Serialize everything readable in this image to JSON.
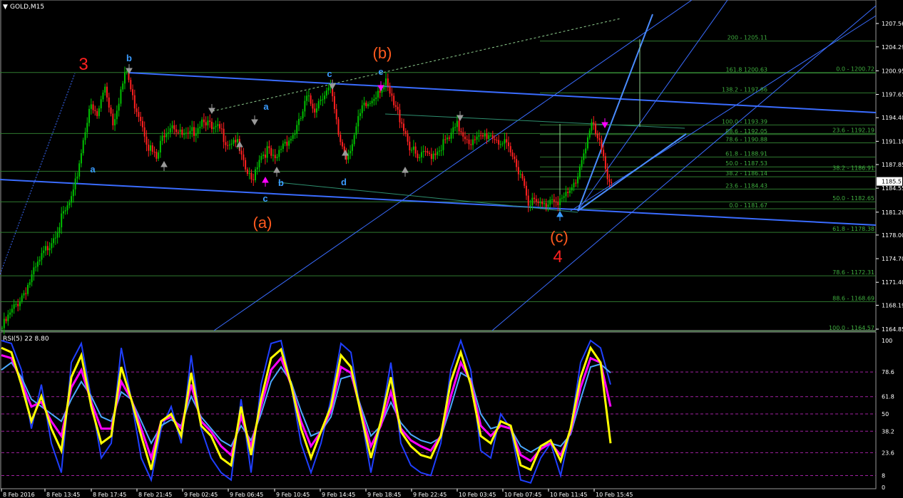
{
  "window": {
    "symbol_title": "GOLD,M15"
  },
  "indicator": {
    "title": "RSI(5) 22 8.80"
  },
  "price_axis": {
    "labels": [
      "1207.56",
      "1204.29",
      "1200.95",
      "1197.65",
      "1194.40",
      "1191.10",
      "1187.85",
      "1185.5",
      "1184.55",
      "1181.20",
      "1178.00",
      "1174.70",
      "1171.40",
      "1168.19",
      "1164.85"
    ],
    "values": [
      1207.56,
      1204.29,
      1200.95,
      1197.65,
      1194.4,
      1191.1,
      1187.85,
      1185.5,
      1184.55,
      1181.2,
      1178.0,
      1174.7,
      1171.4,
      1168.19,
      1164.85
    ],
    "current_label": "1185.5"
  },
  "rsi_axis": {
    "labels": [
      "100",
      "78.6",
      "61.8",
      "50",
      "38.2",
      "23.6",
      "8",
      "0"
    ],
    "values": [
      100,
      78.6,
      61.8,
      50,
      38.2,
      23.6,
      8,
      0
    ]
  },
  "time_axis": [
    "8 Feb 2016",
    "8 Feb 13:45",
    "8 Feb 17:45",
    "8 Feb 21:45",
    "9 Feb 02:45",
    "9 Feb 06:45",
    "9 Feb 10:45",
    "9 Feb 14:45",
    "9 Feb 18:45",
    "9 Feb 22:45",
    "10 Feb 03:45",
    "10 Feb 07:45",
    "10 Feb 11:45",
    "10 Feb 15:45"
  ],
  "wave_labels": [
    {
      "text": "3",
      "color": "#ff2020"
    },
    {
      "text": "b",
      "color": "#3a9bff"
    },
    {
      "text": "a",
      "color": "#3a9bff"
    },
    {
      "text": "a",
      "color": "#3a9bff"
    },
    {
      "text": "c",
      "color": "#3a9bff"
    },
    {
      "text": "b",
      "color": "#3a9bff"
    },
    {
      "text": "(a)",
      "color": "#ff5a1e"
    },
    {
      "text": "c",
      "color": "#3a9bff"
    },
    {
      "text": "d",
      "color": "#3a9bff"
    },
    {
      "text": "e",
      "color": "#3a9bff"
    },
    {
      "text": "(b)",
      "color": "#ff5a1e"
    },
    {
      "text": "(c)",
      "color": "#ff5a1e"
    },
    {
      "text": "4",
      "color": "#ff2020"
    }
  ],
  "fib_labels": [
    {
      "text": "200 - 1205.11",
      "value": 1205.11
    },
    {
      "text": "161.8 1200.63",
      "value": 1200.63
    },
    {
      "text": "0.0 - 1200.72",
      "value": 1200.72
    },
    {
      "text": "138.2 - 1197.86",
      "value": 1197.86
    },
    {
      "text": "100.0 - 1193.39",
      "value": 1193.39
    },
    {
      "text": "88.6 - 1192.05",
      "value": 1192.05
    },
    {
      "text": "23.6 - 1192.19",
      "value": 1192.19
    },
    {
      "text": "78.6 - 1190.88",
      "value": 1190.88
    },
    {
      "text": "61.8 - 1188.91",
      "value": 1188.91
    },
    {
      "text": "50.0 - 1187.53",
      "value": 1187.53
    },
    {
      "text": "38.2 - 1186.91",
      "value": 1186.91
    },
    {
      "text": "38.2 - 1186.14",
      "value": 1186.14
    },
    {
      "text": "23.6 - 1184.43",
      "value": 1184.43
    },
    {
      "text": "50.0 - 1182.65",
      "value": 1182.65
    },
    {
      "text": "0.0 - 1181.67",
      "value": 1181.67
    },
    {
      "text": "61.8 - 1178.38",
      "value": 1178.38
    },
    {
      "text": "78.6 - 1172.31",
      "value": 1172.31
    },
    {
      "text": "88.6 - 1168.69",
      "value": 1168.69
    },
    {
      "text": "100.0 - 1164.57",
      "value": 1164.57
    }
  ],
  "chart_data": {
    "type": "candlestick",
    "symbol": "GOLD",
    "timeframe": "M15",
    "ylim": [
      1164.0,
      1210.0
    ],
    "colors": {
      "bull": "#00c000",
      "bear": "#ff2020",
      "channel": "#3a6cff",
      "fib": "#2f7a2f",
      "rsi_yellow": "#ffff00",
      "rsi_magenta": "#ff00ff",
      "rsi_blue": "#1f3fff",
      "rsi_light": "#4aa8ff"
    },
    "close_path": [
      [
        0,
        1165.0
      ],
      [
        12,
        1170.5
      ],
      [
        20,
        1174.8
      ],
      [
        26,
        1178.0
      ],
      [
        32,
        1181.2
      ],
      [
        36,
        1183.5
      ],
      [
        40,
        1189.8
      ],
      [
        44,
        1195.9
      ],
      [
        48,
        1194.5
      ],
      [
        52,
        1198.9
      ],
      [
        56,
        1193.8
      ],
      [
        60,
        1198.2
      ],
      [
        63,
        1200.9
      ],
      [
        66,
        1197.0
      ],
      [
        70,
        1194.5
      ],
      [
        74,
        1190.5
      ],
      [
        78,
        1188.5
      ],
      [
        82,
        1192.5
      ],
      [
        86,
        1193.8
      ],
      [
        90,
        1192.0
      ],
      [
        94,
        1191.5
      ],
      [
        98,
        1193.0
      ],
      [
        102,
        1194.6
      ],
      [
        106,
        1192.5
      ],
      [
        110,
        1192.7
      ],
      [
        114,
        1191.0
      ],
      [
        118,
        1191.5
      ],
      [
        122,
        1187.6
      ],
      [
        126,
        1185.5
      ],
      [
        130,
        1189.0
      ],
      [
        134,
        1189.9
      ],
      [
        138,
        1188.0
      ],
      [
        142,
        1191.0
      ],
      [
        146,
        1191.6
      ],
      [
        150,
        1193.4
      ],
      [
        154,
        1197.0
      ],
      [
        158,
        1195.8
      ],
      [
        162,
        1197.8
      ],
      [
        166,
        1198.3
      ],
      [
        170,
        1192.0
      ],
      [
        174,
        1189.0
      ],
      [
        178,
        1192.0
      ],
      [
        182,
        1195.5
      ],
      [
        186,
        1196.5
      ],
      [
        190,
        1198.5
      ],
      [
        194,
        1199.0
      ],
      [
        198,
        1196.0
      ],
      [
        202,
        1194.0
      ],
      [
        206,
        1190.5
      ],
      [
        210,
        1188.5
      ],
      [
        214,
        1189.2
      ],
      [
        218,
        1189.5
      ],
      [
        222,
        1190.5
      ],
      [
        226,
        1191.4
      ],
      [
        230,
        1193.2
      ],
      [
        234,
        1192.0
      ],
      [
        238,
        1190.8
      ],
      [
        242,
        1191.5
      ],
      [
        246,
        1192.2
      ],
      [
        250,
        1191.5
      ],
      [
        254,
        1190.5
      ],
      [
        258,
        1188.8
      ],
      [
        262,
        1186.9
      ],
      [
        266,
        1183.0
      ],
      [
        270,
        1182.3
      ],
      [
        274,
        1182.0
      ],
      [
        278,
        1183.5
      ],
      [
        282,
        1182.8
      ],
      [
        286,
        1183.4
      ],
      [
        290,
        1185.5
      ],
      [
        294,
        1189.8
      ],
      [
        298,
        1193.5
      ],
      [
        302,
        1190.5
      ],
      [
        306,
        1186.5
      ],
      [
        309,
        1185.0
      ]
    ],
    "rsi_yellow": [
      95,
      92,
      70,
      45,
      62,
      40,
      25,
      75,
      90,
      55,
      30,
      35,
      82,
      60,
      35,
      12,
      45,
      50,
      35,
      78,
      42,
      35,
      20,
      15,
      55,
      22,
      60,
      88,
      94,
      70,
      40,
      20,
      38,
      55,
      90,
      82,
      50,
      20,
      45,
      75,
      38,
      28,
      22,
      20,
      35,
      72,
      92,
      70,
      35,
      30,
      45,
      42,
      15,
      12,
      28,
      32,
      18,
      40,
      75,
      95,
      85,
      30
    ],
    "rsi_magenta": [
      90,
      88,
      72,
      55,
      58,
      45,
      35,
      68,
      80,
      58,
      40,
      40,
      72,
      60,
      40,
      20,
      45,
      48,
      40,
      70,
      45,
      38,
      28,
      22,
      48,
      28,
      55,
      80,
      88,
      70,
      45,
      28,
      38,
      52,
      82,
      78,
      52,
      28,
      42,
      65,
      40,
      32,
      28,
      25,
      35,
      62,
      85,
      72,
      42,
      35,
      42,
      40,
      22,
      18,
      26,
      30,
      22,
      38,
      68,
      88,
      85,
      55
    ],
    "rsi_blue": [
      100,
      98,
      80,
      40,
      70,
      30,
      10,
      85,
      98,
      60,
      20,
      30,
      95,
      60,
      20,
      5,
      40,
      55,
      30,
      90,
      40,
      20,
      10,
      5,
      60,
      10,
      70,
      98,
      100,
      70,
      30,
      10,
      30,
      60,
      98,
      92,
      50,
      10,
      45,
      85,
      30,
      15,
      10,
      8,
      30,
      80,
      100,
      80,
      25,
      20,
      50,
      40,
      5,
      3,
      20,
      30,
      8,
      40,
      85,
      100,
      95,
      70
    ],
    "rsi_light": [
      80,
      85,
      75,
      60,
      55,
      50,
      45,
      60,
      72,
      62,
      48,
      45,
      65,
      60,
      45,
      30,
      42,
      46,
      42,
      62,
      48,
      40,
      32,
      28,
      42,
      32,
      50,
      72,
      82,
      72,
      52,
      35,
      38,
      48,
      74,
      76,
      55,
      35,
      42,
      58,
      44,
      36,
      32,
      30,
      34,
      55,
      78,
      74,
      50,
      40,
      42,
      40,
      28,
      24,
      28,
      30,
      28,
      36,
      60,
      82,
      84,
      78
    ]
  }
}
